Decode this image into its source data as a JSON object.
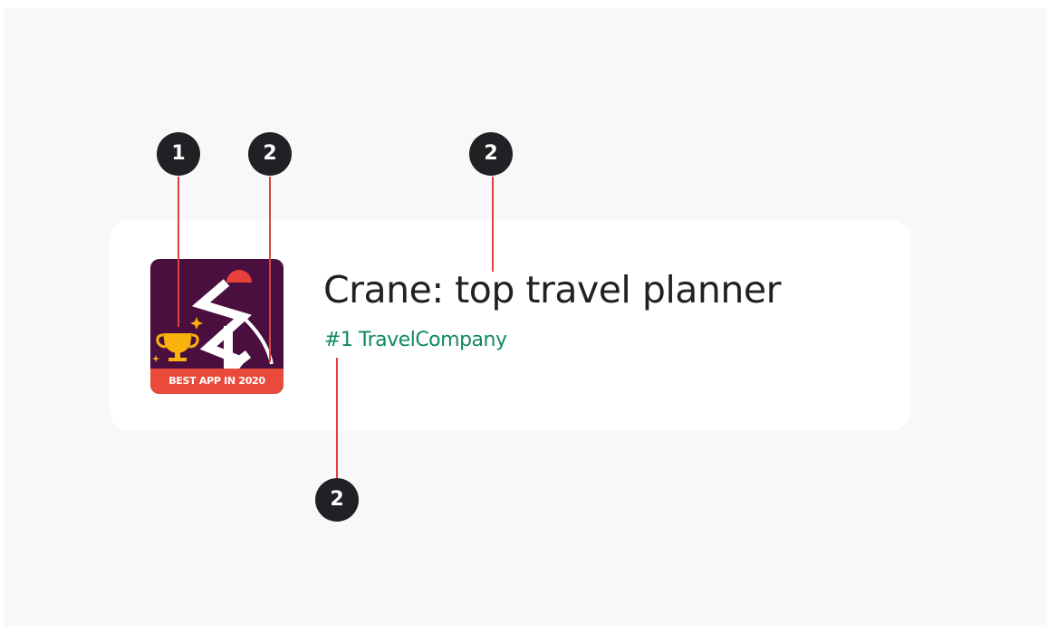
{
  "app": {
    "title": "Crane: top travel planner",
    "developer": "#1 TravelCompany",
    "icon": {
      "name": "crane-app-icon",
      "banner": "BEST APP IN 2020",
      "background_color": "#4a0f3f",
      "banner_color": "#ea4a3b",
      "trophy_color": "#f9b30a",
      "crane_color": "#ffffff",
      "crane_head_color": "#e8403a"
    }
  },
  "callouts": [
    {
      "number": "1"
    },
    {
      "number": "2"
    },
    {
      "number": "2"
    },
    {
      "number": "2"
    }
  ],
  "colors": {
    "page_background": "#f8f8f8",
    "card_background": "#ffffff",
    "title_text": "#202124",
    "developer_text": "#108a5c",
    "callout_line": "#e0413a",
    "callout_badge": "#202124"
  }
}
